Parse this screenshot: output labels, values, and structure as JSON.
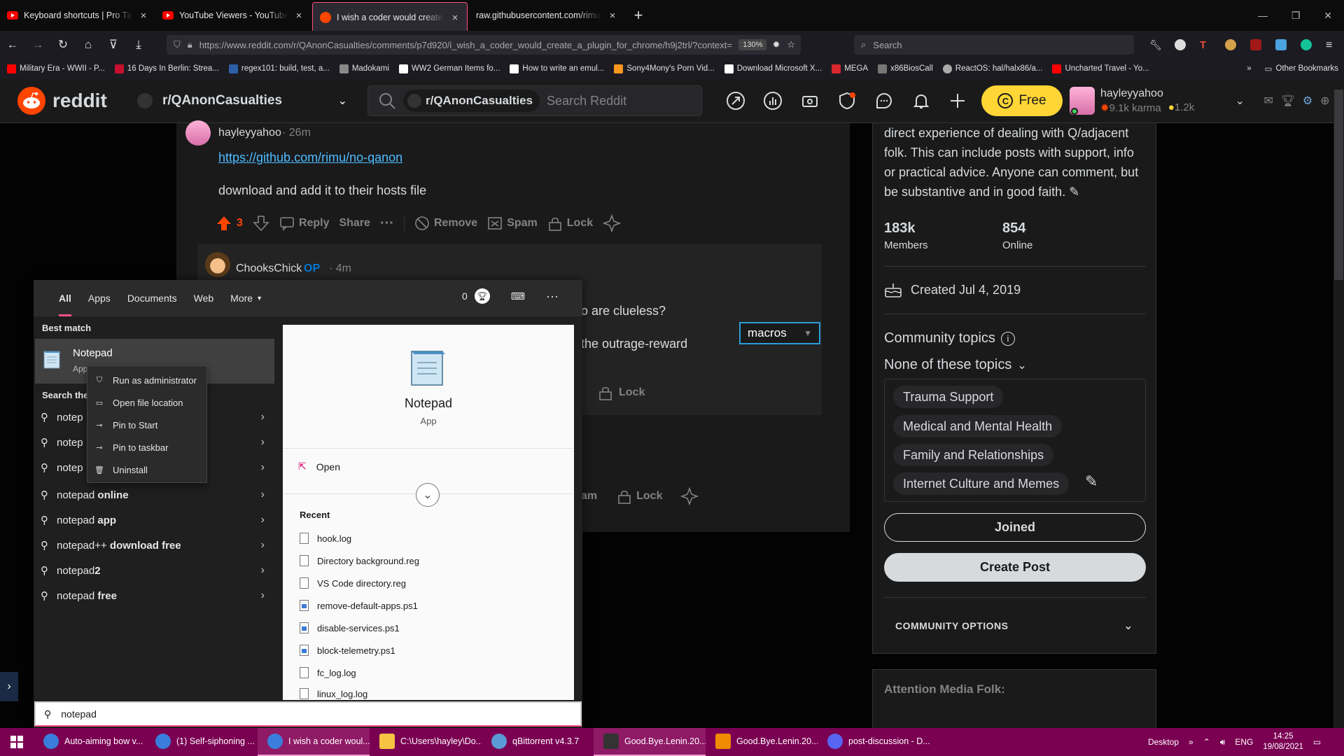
{
  "browser": {
    "tabs": [
      {
        "title": "Keyboard shortcuts | Pro Tips fo",
        "icon": "youtube-icon"
      },
      {
        "title": "YouTube Viewers - YouTube",
        "icon": "youtube-icon"
      },
      {
        "title": "I wish a coder would create a pl",
        "icon": "reddit-icon",
        "active": true
      },
      {
        "title": "raw.githubusercontent.com/rimu/n",
        "icon": "none"
      }
    ],
    "url": "https://www.reddit.com/r/QAnonCasualties/comments/p7d920/i_wish_a_coder_would_create_a_plugin_for_chrome/h9j2trl/?context=",
    "zoom": "130%",
    "search_placeholder": "Search",
    "bookmarks": [
      {
        "label": "Military Era - WWII - P...",
        "color": "#ff0000"
      },
      {
        "label": "16 Days In Berlin: Strea...",
        "color": "#c8102e"
      },
      {
        "label": "regex101: build, test, a...",
        "color": "#2c5fa8"
      },
      {
        "label": "Madokami",
        "color": "#888888"
      },
      {
        "label": "WW2 German Items fo...",
        "color": "#ffffff"
      },
      {
        "label": "How to write an emul...",
        "color": "#ffffff"
      },
      {
        "label": "Sony4Mony's Porn Vid...",
        "color": "#f7971d"
      },
      {
        "label": "Download Microsoft X...",
        "color": "#ffffff"
      },
      {
        "label": "MEGA",
        "color": "#d9272e"
      },
      {
        "label": "x86BiosCall",
        "color": "#777777"
      },
      {
        "label": "ReactOS: hal/halx86/a...",
        "color": "#aaaaaa"
      },
      {
        "label": "Uncharted Travel - Yo...",
        "color": "#ff0000"
      }
    ],
    "other_bookmarks": "Other Bookmarks"
  },
  "reddit": {
    "logo_text": "reddit",
    "subreddit": "r/QAnonCasualties",
    "search_chip": "r/QAnonCasualties",
    "search_placeholder": "Search Reddit",
    "free_label": "Free",
    "username": "hayleyyahoo",
    "karma": "9.1k karma",
    "coins": "1.2k",
    "comment1": {
      "author": "hayleyyahoo",
      "time": "· 26m",
      "link": "https://github.com/rimu/no-qanon",
      "body": "download and add it to their hosts file",
      "votes": "3",
      "actions": [
        "Reply",
        "Share",
        "Remove",
        "Spam",
        "Lock"
      ]
    },
    "comment2": {
      "author": "ChooksChick",
      "op": "OP",
      "time": "· 4m",
      "line1": "o are clueless?",
      "line2": "the outrage-reward",
      "lock": "Lock"
    },
    "comment3_actions": [
      "am",
      "Lock"
    ],
    "macros_label": "macros",
    "sidebar": {
      "about": "direct experience of dealing with Q/adjacent folk. This can include posts with support, info or practical advice. Anyone can comment, but be substantive and in good faith.",
      "members_count": "183k",
      "members_label": "Members",
      "online_count": "854",
      "online_label": "Online",
      "created": "Created Jul 4, 2019",
      "topics_heading": "Community topics",
      "topics_selector": "None of these topics",
      "topics": [
        "Trauma Support",
        "Medical and Mental Health",
        "Family and Relationships",
        "Internet Culture and Memes"
      ],
      "joined": "Joined",
      "create_post": "Create Post",
      "community_options": "COMMUNITY OPTIONS",
      "attention": "Attention Media Folk:"
    }
  },
  "startmenu": {
    "tabs": [
      "All",
      "Apps",
      "Documents",
      "Web",
      "More"
    ],
    "points": "0",
    "best_match_label": "Best match",
    "best_match_name": "Notepad",
    "best_match_sub": "App",
    "search_web_label": "Search the",
    "results": [
      {
        "query": "notep",
        "bold": ""
      },
      {
        "query": "notep",
        "bold": ""
      },
      {
        "query": "notep",
        "bold": ""
      },
      {
        "query": "notepad",
        "bold": " online"
      },
      {
        "query": "notepad",
        "bold": " app"
      },
      {
        "query": "notepad++",
        "bold": " download free"
      },
      {
        "query": "notepad",
        "bold": "2"
      },
      {
        "query": "notepad",
        "bold": " free"
      }
    ],
    "context_menu": [
      "Run as administrator",
      "Open file location",
      "Pin to Start",
      "Pin to taskbar",
      "Uninstall"
    ],
    "app_name": "Notepad",
    "app_sub": "App",
    "open_label": "Open",
    "recent_label": "Recent",
    "recent": [
      {
        "name": "hook.log",
        "type": "txt"
      },
      {
        "name": "Directory background.reg",
        "type": "reg"
      },
      {
        "name": "VS Code directory.reg",
        "type": "reg"
      },
      {
        "name": "remove-default-apps.ps1",
        "type": "ps"
      },
      {
        "name": "disable-services.ps1",
        "type": "ps"
      },
      {
        "name": "block-telemetry.ps1",
        "type": "ps"
      },
      {
        "name": "fc_log.log",
        "type": "txt"
      },
      {
        "name": "linux_log.log",
        "type": "txt"
      }
    ],
    "search_value": "notepad"
  },
  "taskbar": {
    "items": [
      {
        "label": "Auto-aiming bow v...",
        "color": "#3b7ddb"
      },
      {
        "label": "(1) Self-siphoning ...",
        "color": "#3b7ddb"
      },
      {
        "label": "I wish a coder woul...",
        "color": "#3b7ddb",
        "active": true
      },
      {
        "label": "C:\\Users\\hayley\\Do...",
        "color": "#f5c242"
      },
      {
        "label": "qBittorrent v4.3.7",
        "color": "#5b9bd5"
      },
      {
        "label": "Good.Bye.Lenin.20...",
        "color": "#333333",
        "active": true
      },
      {
        "label": "Good.Bye.Lenin.20...",
        "color": "#f08a00"
      },
      {
        "label": "post-discussion - D...",
        "color": "#5865f2"
      }
    ],
    "desktop": "Desktop",
    "lang": "ENG",
    "time": "14:25",
    "date": "19/08/2021"
  },
  "colors": {
    "reddit_orange": "#ff4500",
    "accent_pink": "#ff4f8b",
    "taskbar": "#7a0052",
    "link_blue": "#4fbcff"
  }
}
